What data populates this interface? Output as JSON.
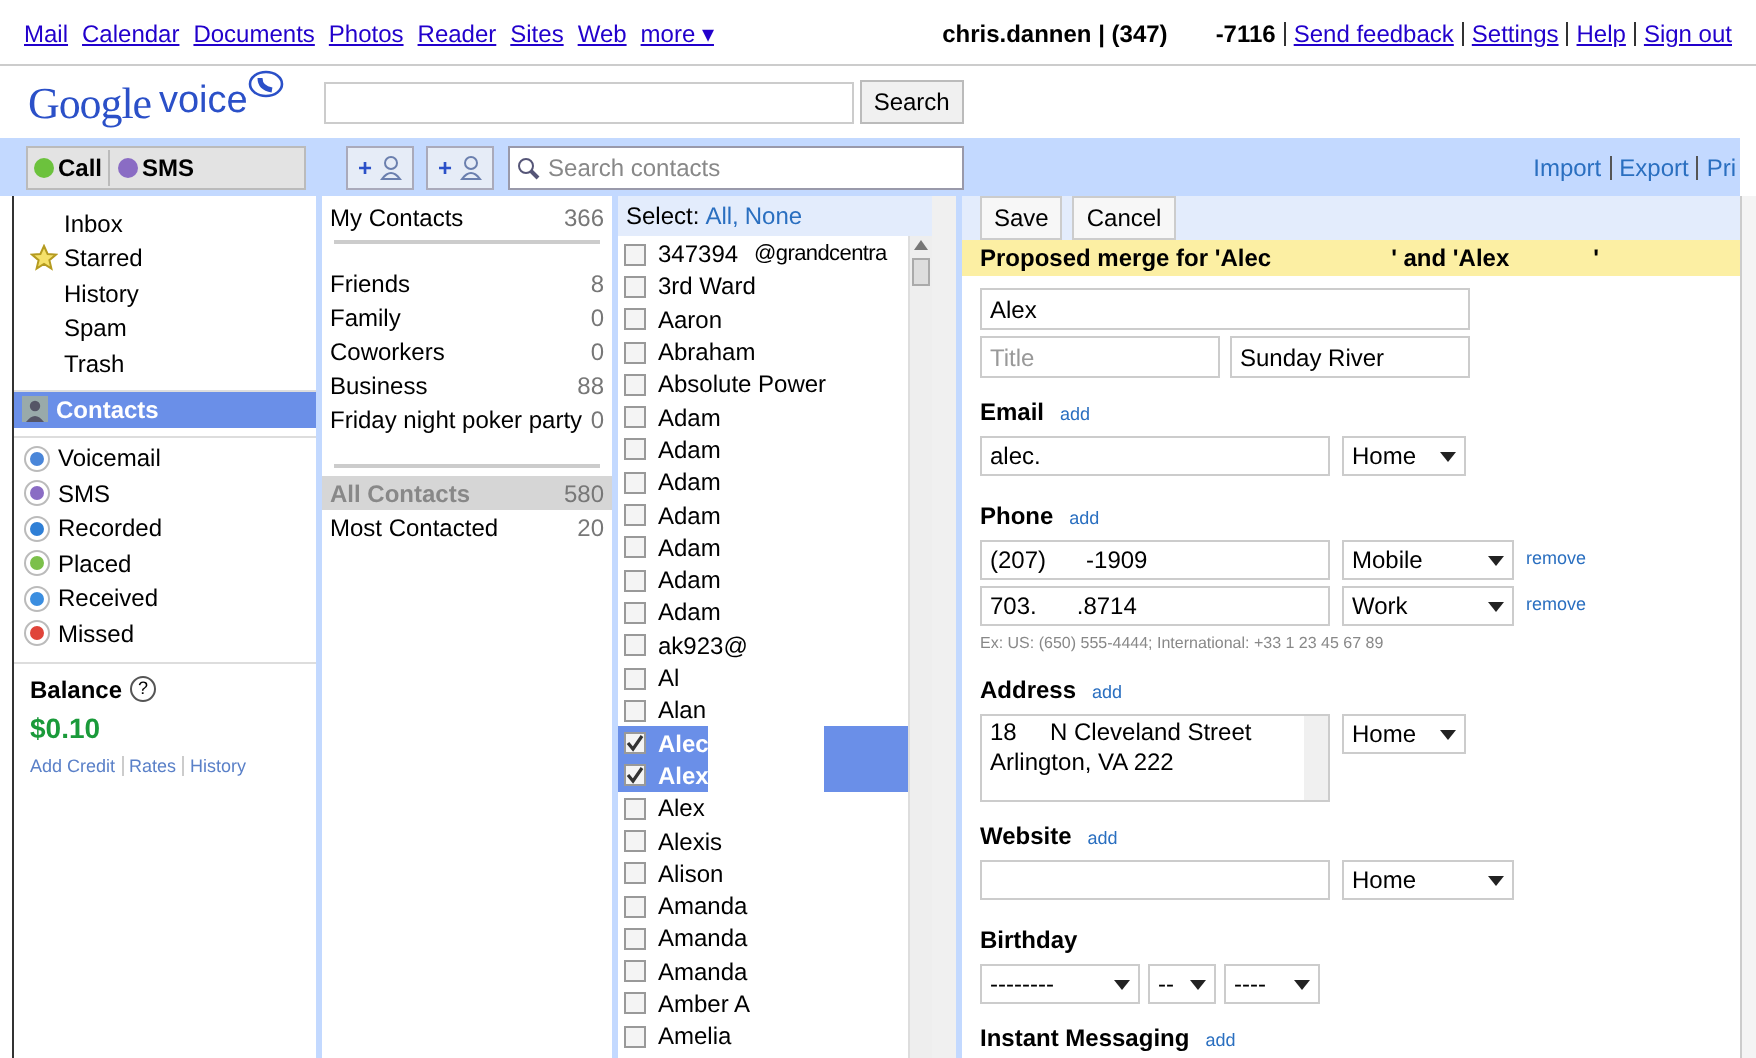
{
  "top_links": [
    {
      "label": "Mail"
    },
    {
      "label": "Calendar"
    },
    {
      "label": "Documents"
    },
    {
      "label": "Photos"
    },
    {
      "label": "Reader"
    },
    {
      "label": "Sites"
    },
    {
      "label": "Web"
    }
  ],
  "more_link": "more ▾",
  "account": [
    "chris.dannen | (347)",
    "-7116"
  ],
  "account_links": [
    "Send feedback",
    "Settings",
    "Help",
    "Sign out"
  ],
  "logo": {
    "google": "Google",
    "voice": "voice"
  },
  "search_button": "Search",
  "toolbar": {
    "call": "Call",
    "sms": "SMS",
    "add_buttons": [
      "+",
      "+"
    ],
    "search_placeholder": "Search contacts",
    "links": [
      "Import",
      "Export",
      "Pri"
    ]
  },
  "nav": {
    "items": [
      {
        "label": "Inbox",
        "kind": "plain"
      },
      {
        "label": "Starred",
        "kind": "star"
      },
      {
        "label": "History",
        "kind": "plain"
      },
      {
        "label": "Spam",
        "kind": "plain"
      },
      {
        "label": "Trash",
        "kind": "plain"
      }
    ],
    "contacts": {
      "label": "Contacts",
      "selected": true
    },
    "types": [
      {
        "label": "Voicemail",
        "color": "#4a86d9"
      },
      {
        "label": "SMS",
        "color": "#8a6cc4"
      },
      {
        "label": "Recorded",
        "color": "#2f7fd6"
      },
      {
        "label": "Placed",
        "color": "#7cc04b"
      },
      {
        "label": "Received",
        "color": "#3b8ee0"
      },
      {
        "label": "Missed",
        "color": "#e0443a"
      }
    ],
    "balance": {
      "label": "Balance",
      "help": "?",
      "amount": "$0.10",
      "links": [
        "Add Credit",
        "Rates",
        "History"
      ]
    }
  },
  "groups": {
    "top": {
      "label": "My Contacts",
      "count": "366"
    },
    "items": [
      {
        "label": "Friends",
        "count": "8"
      },
      {
        "label": "Family",
        "count": "0"
      },
      {
        "label": "Coworkers",
        "count": "0"
      },
      {
        "label": "Business",
        "count": "88"
      },
      {
        "label": "Friday night poker party",
        "count": "0"
      }
    ],
    "bottom": [
      {
        "label": "All Contacts",
        "count": "580",
        "selected": true
      },
      {
        "label": "Most Contacted",
        "count": "20",
        "selected": false
      }
    ]
  },
  "contact_list": {
    "select_label": "Select:",
    "select_all": "All,",
    "select_none": "None",
    "items": [
      {
        "name": "347394",
        "extra": "@grandcentra",
        "checked": false,
        "selected": false
      },
      {
        "name": "3rd Ward",
        "checked": false,
        "selected": false
      },
      {
        "name": "Aaron",
        "checked": false,
        "selected": false
      },
      {
        "name": "Abraham",
        "checked": false,
        "selected": false
      },
      {
        "name": "Absolute Power",
        "checked": false,
        "selected": false
      },
      {
        "name": "Adam",
        "checked": false,
        "selected": false
      },
      {
        "name": "Adam",
        "checked": false,
        "selected": false
      },
      {
        "name": "Adam",
        "checked": false,
        "selected": false
      },
      {
        "name": "Adam",
        "checked": false,
        "selected": false
      },
      {
        "name": "Adam",
        "checked": false,
        "selected": false
      },
      {
        "name": "Adam",
        "checked": false,
        "selected": false
      },
      {
        "name": "Adam",
        "checked": false,
        "selected": false
      },
      {
        "name": "ak923@",
        "checked": false,
        "selected": false
      },
      {
        "name": "Al",
        "checked": false,
        "selected": false
      },
      {
        "name": "Alan",
        "checked": false,
        "selected": false
      },
      {
        "name": "Alec",
        "checked": true,
        "selected": true
      },
      {
        "name": "Alex",
        "checked": true,
        "selected": true
      },
      {
        "name": "Alex",
        "checked": false,
        "selected": false
      },
      {
        "name": "Alexis",
        "checked": false,
        "selected": false
      },
      {
        "name": "Alison",
        "checked": false,
        "selected": false
      },
      {
        "name": "Amanda",
        "checked": false,
        "selected": false
      },
      {
        "name": "Amanda",
        "checked": false,
        "selected": false
      },
      {
        "name": "Amanda",
        "checked": false,
        "selected": false
      },
      {
        "name": "Amber A",
        "checked": false,
        "selected": false
      },
      {
        "name": "Amelia",
        "checked": false,
        "selected": false
      }
    ]
  },
  "form": {
    "buttons": [
      "Save",
      "Cancel"
    ],
    "banner": [
      "Proposed merge for 'Alec",
      "' and 'Alex",
      "'"
    ],
    "name": "Alex",
    "title_placeholder": "Title",
    "company": "Sunday River",
    "sections": [
      {
        "kind": "rows",
        "label": "Email",
        "add": "add",
        "rows": [
          {
            "value": "alec.",
            "type": "Home"
          }
        ]
      },
      {
        "kind": "rows",
        "label": "Phone",
        "add": "add",
        "rows": [
          {
            "value": "(207)      -1909",
            "type": "Mobile",
            "remove": "remove"
          },
          {
            "value": "703.      .8714",
            "type": "Work",
            "remove": "remove"
          }
        ],
        "hint": "Ex: US: (650) 555-4444; International: +33 1 23 45 67 89"
      },
      {
        "kind": "address",
        "label": "Address",
        "add": "add",
        "lines": [
          "18     N Cleveland Street",
          "Arlington, VA 222"
        ],
        "type": "Home"
      },
      {
        "kind": "rows",
        "label": "Website",
        "add": "add",
        "rows": [
          {
            "value": "",
            "type": "Home"
          }
        ]
      },
      {
        "kind": "birthday",
        "label": "Birthday",
        "selects": [
          "--------",
          "--",
          "----"
        ]
      },
      {
        "kind": "header",
        "label": "Instant Messaging",
        "add": "add"
      }
    ]
  }
}
